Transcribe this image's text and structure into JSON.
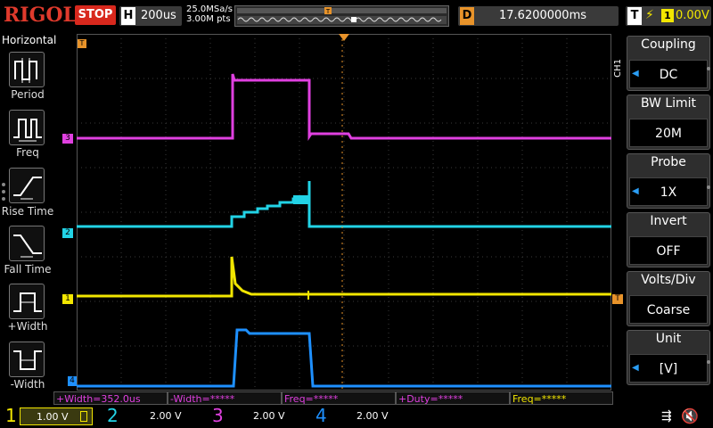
{
  "header": {
    "logo": "RIGOL",
    "run_state": "STOP",
    "horizontal_label": "H",
    "timebase": "200us",
    "sample_rate": "25.0MSa/s",
    "memory_depth": "3.00M pts",
    "delay_label": "D",
    "delay_value": "17.6200000ms",
    "trigger_label": "T",
    "trigger_source": "1",
    "trigger_level": "0.00V"
  },
  "left_menu": {
    "title": "Horizontal",
    "items": [
      {
        "label": "Period"
      },
      {
        "label": "Freq"
      },
      {
        "label": "Rise Time"
      },
      {
        "label": "Fall Time"
      },
      {
        "label": "+Width"
      },
      {
        "label": "-Width"
      }
    ]
  },
  "right_menu": {
    "channel_tag": "CH1",
    "items": [
      {
        "title": "Coupling",
        "value": "DC"
      },
      {
        "title": "BW Limit",
        "value": "20M"
      },
      {
        "title": "Probe",
        "value": "1X"
      },
      {
        "title": "Invert",
        "value": "OFF"
      },
      {
        "title": "Volts/Div",
        "value": "Coarse"
      },
      {
        "title": "Unit",
        "value": "[V]"
      }
    ]
  },
  "measurements": [
    {
      "text": "+Width=352.0us",
      "color": "#e040e0"
    },
    {
      "text": "-Width=*****",
      "color": "#e040e0"
    },
    {
      "text": "Freq=*****",
      "color": "#e040e0"
    },
    {
      "text": "+Duty=*****",
      "color": "#e040e0"
    },
    {
      "text": "Freq=*****",
      "color": "#f2e600"
    }
  ],
  "channels": [
    {
      "number": "1",
      "scale": "1.00 V",
      "color": "#f2e600"
    },
    {
      "number": "2",
      "scale": "2.00 V",
      "color": "#22d3e6"
    },
    {
      "number": "3",
      "scale": "2.00 V",
      "color": "#e040e0"
    },
    {
      "number": "4",
      "scale": "2.00 V",
      "color": "#1e90ff"
    }
  ],
  "trace_markers": {
    "ch1": "1",
    "ch2": "2",
    "ch3": "3",
    "ch4": "4",
    "trigger_marker": "T"
  },
  "colors": {
    "ch1": "#f2e600",
    "ch2": "#22d3e6",
    "ch3": "#e040e0",
    "ch4": "#1e90ff",
    "trigger": "#e8932a",
    "accent": "#d8281d"
  },
  "icons": {
    "usb": "usb-icon",
    "speaker": "speaker-muted-icon"
  }
}
